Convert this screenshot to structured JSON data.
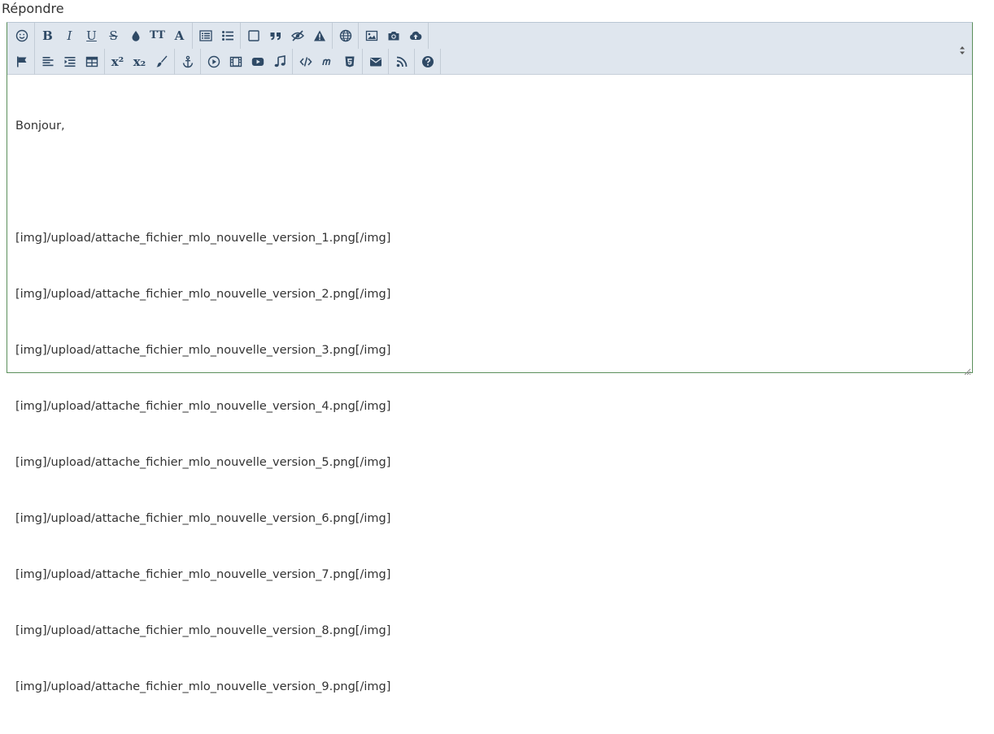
{
  "heading": "Répondre",
  "toolbar": {
    "row1": [
      [
        "smiley-icon"
      ],
      [
        "bold-icon",
        "italic-icon",
        "underline-icon",
        "strikethrough-icon",
        "color-drop-icon",
        "font-size-icon",
        "font-icon"
      ],
      [
        "ordered-list-icon",
        "unordered-list-icon"
      ],
      [
        "box-icon",
        "quote-icon",
        "spoiler-icon",
        "warning-icon"
      ],
      [
        "globe-icon"
      ],
      [
        "image-icon",
        "camera-icon",
        "upload-icon"
      ]
    ],
    "row2": [
      [
        "flag-icon"
      ],
      [
        "align-left-icon",
        "indent-icon",
        "table-icon"
      ],
      [
        "superscript-icon",
        "subscript-icon",
        "brush-icon"
      ],
      [
        "anchor-icon"
      ],
      [
        "play-icon",
        "film-icon",
        "youtube-icon",
        "music-icon"
      ],
      [
        "code-icon",
        "math-icon",
        "html5-icon"
      ],
      [
        "mail-icon"
      ],
      [
        "rss-icon"
      ],
      [
        "help-icon"
      ]
    ],
    "glyphs": {
      "bold": "B",
      "italic": "I",
      "underline": "U",
      "strike": "S",
      "fontsize": "TT",
      "font": "A",
      "sup": "x²",
      "sub": "x₂"
    }
  },
  "editor": {
    "lines": [
      "Bonjour,",
      "",
      "[img]/upload/attache_fichier_mlo_nouvelle_version_1.png[/img]",
      "[img]/upload/attache_fichier_mlo_nouvelle_version_2.png[/img]",
      "[img]/upload/attache_fichier_mlo_nouvelle_version_3.png[/img]",
      "[img]/upload/attache_fichier_mlo_nouvelle_version_4.png[/img]",
      "[img]/upload/attache_fichier_mlo_nouvelle_version_5.png[/img]",
      "[img]/upload/attache_fichier_mlo_nouvelle_version_6.png[/img]",
      "[img]/upload/attache_fichier_mlo_nouvelle_version_7.png[/img]",
      "[img]/upload/attache_fichier_mlo_nouvelle_version_8.png[/img]",
      "[img]/upload/attache_fichier_mlo_nouvelle_version_9.png[/img]"
    ]
  },
  "colors": {
    "toolbar_bg": "#dfe6ee",
    "icon": "#2f4a66",
    "border_focus": "#5b8f5b",
    "text": "#333333"
  }
}
